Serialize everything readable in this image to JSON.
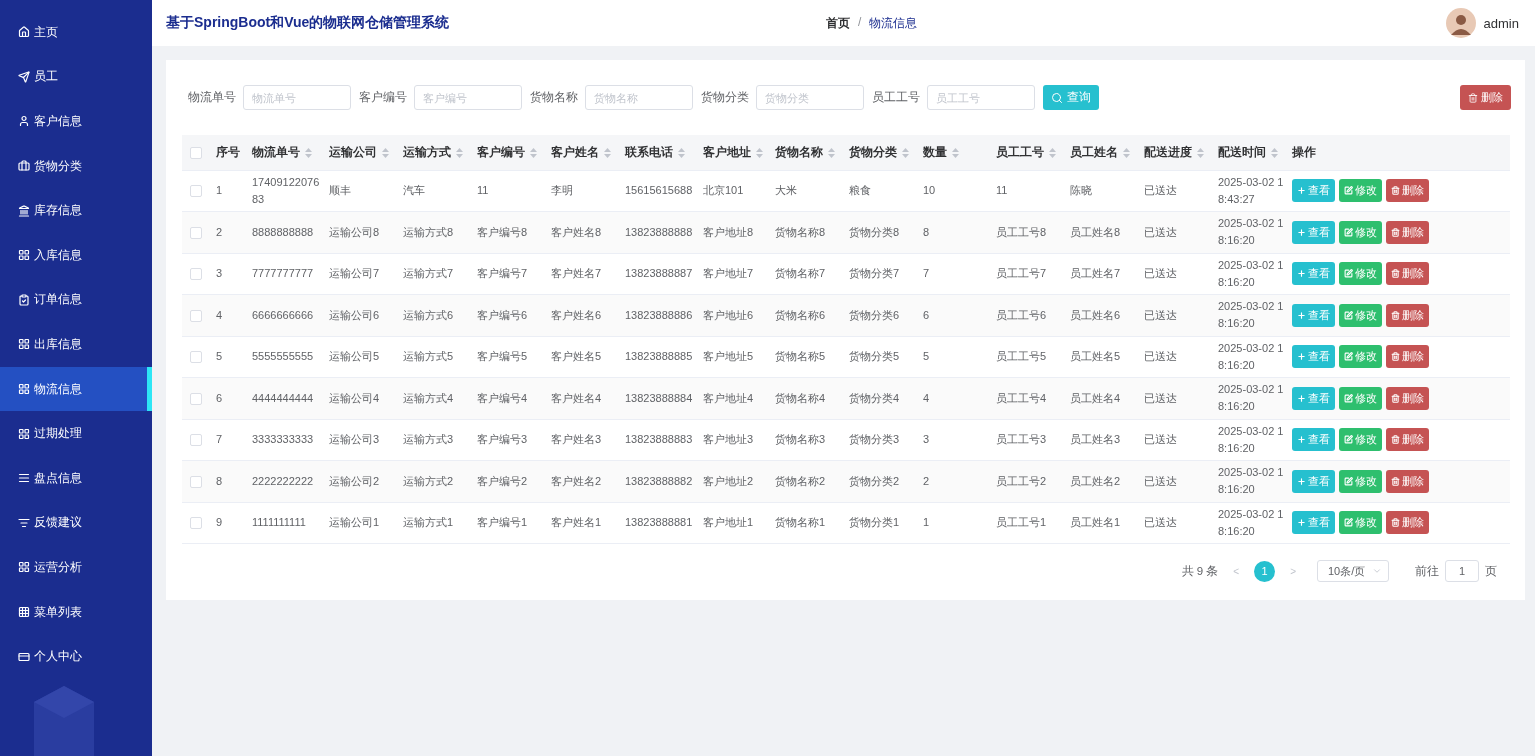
{
  "sidebar": {
    "items": [
      {
        "label": "主页",
        "selected": false
      },
      {
        "label": "员工",
        "selected": false
      },
      {
        "label": "客户信息",
        "selected": false
      },
      {
        "label": "货物分类",
        "selected": false
      },
      {
        "label": "库存信息",
        "selected": false
      },
      {
        "label": "入库信息",
        "selected": false
      },
      {
        "label": "订单信息",
        "selected": false
      },
      {
        "label": "出库信息",
        "selected": false
      },
      {
        "label": "物流信息",
        "selected": true
      },
      {
        "label": "过期处理",
        "selected": false
      },
      {
        "label": "盘点信息",
        "selected": false
      },
      {
        "label": "反馈建议",
        "selected": false
      },
      {
        "label": "运营分析",
        "selected": false
      },
      {
        "label": "菜单列表",
        "selected": false
      },
      {
        "label": "个人中心",
        "selected": false
      }
    ]
  },
  "header": {
    "title": "基于SpringBoot和Vue的物联网仓储管理系统",
    "breadcrumb": {
      "home": "首页",
      "separator": "/",
      "current": "物流信息"
    },
    "user": "admin"
  },
  "search": {
    "fields": [
      {
        "label": "物流单号",
        "placeholder": "物流单号"
      },
      {
        "label": "客户编号",
        "placeholder": "客户编号"
      },
      {
        "label": "货物名称",
        "placeholder": "货物名称"
      },
      {
        "label": "货物分类",
        "placeholder": "货物分类"
      },
      {
        "label": "员工工号",
        "placeholder": "员工工号"
      }
    ],
    "query_button": "查询",
    "delete_button": "删除"
  },
  "table": {
    "select_all": {
      "checked": false
    },
    "columns": [
      {
        "label": "序号",
        "sortable": false
      },
      {
        "label": "物流单号",
        "sortable": true
      },
      {
        "label": "运输公司",
        "sortable": true
      },
      {
        "label": "运输方式",
        "sortable": true
      },
      {
        "label": "客户编号",
        "sortable": true
      },
      {
        "label": "客户姓名",
        "sortable": true
      },
      {
        "label": "联系电话",
        "sortable": true
      },
      {
        "label": "客户地址",
        "sortable": true
      },
      {
        "label": "货物名称",
        "sortable": true
      },
      {
        "label": "货物分类",
        "sortable": true
      },
      {
        "label": "数量",
        "sortable": true
      },
      {
        "label": "员工工号",
        "sortable": true
      },
      {
        "label": "员工姓名",
        "sortable": true
      },
      {
        "label": "配送进度",
        "sortable": true
      },
      {
        "label": "配送时间",
        "sortable": true
      },
      {
        "label": "操作",
        "sortable": false
      }
    ],
    "rows": [
      {
        "checked": false,
        "cells": [
          "1",
          "1740912207683",
          "顺丰",
          "汽车",
          "11",
          "李明",
          "15615615688",
          "北京101",
          "大米",
          "粮食",
          "10",
          "11",
          "陈晓",
          "已送达",
          "2025-03-02 18:43:27"
        ],
        "actions": [
          {
            "kind": "view",
            "label": "查看"
          },
          {
            "kind": "edit",
            "label": "修改"
          },
          {
            "kind": "delete",
            "label": "删除"
          }
        ]
      },
      {
        "checked": false,
        "cells": [
          "2",
          "8888888888",
          "运输公司8",
          "运输方式8",
          "客户编号8",
          "客户姓名8",
          "13823888888",
          "客户地址8",
          "货物名称8",
          "货物分类8",
          "8",
          "员工工号8",
          "员工姓名8",
          "已送达",
          "2025-03-02 18:16:20"
        ],
        "actions": [
          {
            "kind": "view",
            "label": "查看"
          },
          {
            "kind": "edit",
            "label": "修改"
          },
          {
            "kind": "delete",
            "label": "删除"
          }
        ]
      },
      {
        "checked": false,
        "cells": [
          "3",
          "7777777777",
          "运输公司7",
          "运输方式7",
          "客户编号7",
          "客户姓名7",
          "13823888887",
          "客户地址7",
          "货物名称7",
          "货物分类7",
          "7",
          "员工工号7",
          "员工姓名7",
          "已送达",
          "2025-03-02 18:16:20"
        ],
        "actions": [
          {
            "kind": "view",
            "label": "查看"
          },
          {
            "kind": "edit",
            "label": "修改"
          },
          {
            "kind": "delete",
            "label": "删除"
          }
        ]
      },
      {
        "checked": false,
        "cells": [
          "4",
          "6666666666",
          "运输公司6",
          "运输方式6",
          "客户编号6",
          "客户姓名6",
          "13823888886",
          "客户地址6",
          "货物名称6",
          "货物分类6",
          "6",
          "员工工号6",
          "员工姓名6",
          "已送达",
          "2025-03-02 18:16:20"
        ],
        "actions": [
          {
            "kind": "view",
            "label": "查看"
          },
          {
            "kind": "edit",
            "label": "修改"
          },
          {
            "kind": "delete",
            "label": "删除"
          }
        ]
      },
      {
        "checked": false,
        "cells": [
          "5",
          "5555555555",
          "运输公司5",
          "运输方式5",
          "客户编号5",
          "客户姓名5",
          "13823888885",
          "客户地址5",
          "货物名称5",
          "货物分类5",
          "5",
          "员工工号5",
          "员工姓名5",
          "已送达",
          "2025-03-02 18:16:20"
        ],
        "actions": [
          {
            "kind": "view",
            "label": "查看"
          },
          {
            "kind": "edit",
            "label": "修改"
          },
          {
            "kind": "delete",
            "label": "删除"
          }
        ]
      },
      {
        "checked": false,
        "cells": [
          "6",
          "4444444444",
          "运输公司4",
          "运输方式4",
          "客户编号4",
          "客户姓名4",
          "13823888884",
          "客户地址4",
          "货物名称4",
          "货物分类4",
          "4",
          "员工工号4",
          "员工姓名4",
          "已送达",
          "2025-03-02 18:16:20"
        ],
        "actions": [
          {
            "kind": "view",
            "label": "查看"
          },
          {
            "kind": "edit",
            "label": "修改"
          },
          {
            "kind": "delete",
            "label": "删除"
          }
        ]
      },
      {
        "checked": false,
        "cells": [
          "7",
          "3333333333",
          "运输公司3",
          "运输方式3",
          "客户编号3",
          "客户姓名3",
          "13823888883",
          "客户地址3",
          "货物名称3",
          "货物分类3",
          "3",
          "员工工号3",
          "员工姓名3",
          "已送达",
          "2025-03-02 18:16:20"
        ],
        "actions": [
          {
            "kind": "view",
            "label": "查看"
          },
          {
            "kind": "edit",
            "label": "修改"
          },
          {
            "kind": "delete",
            "label": "删除"
          }
        ]
      },
      {
        "checked": false,
        "cells": [
          "8",
          "2222222222",
          "运输公司2",
          "运输方式2",
          "客户编号2",
          "客户姓名2",
          "13823888882",
          "客户地址2",
          "货物名称2",
          "货物分类2",
          "2",
          "员工工号2",
          "员工姓名2",
          "已送达",
          "2025-03-02 18:16:20"
        ],
        "actions": [
          {
            "kind": "view",
            "label": "查看"
          },
          {
            "kind": "edit",
            "label": "修改"
          },
          {
            "kind": "delete",
            "label": "删除"
          }
        ]
      },
      {
        "checked": false,
        "cells": [
          "9",
          "1111111111",
          "运输公司1",
          "运输方式1",
          "客户编号1",
          "客户姓名1",
          "13823888881",
          "客户地址1",
          "货物名称1",
          "货物分类1",
          "1",
          "员工工号1",
          "员工姓名1",
          "已送达",
          "2025-03-02 18:16:20"
        ],
        "actions": [
          {
            "kind": "view",
            "label": "查看"
          },
          {
            "kind": "edit",
            "label": "修改"
          },
          {
            "kind": "delete",
            "label": "删除"
          }
        ]
      }
    ]
  },
  "pagination": {
    "total": "共 9 条",
    "prev": "<",
    "pages": [
      {
        "label": "1",
        "selected": true
      }
    ],
    "next": ">",
    "page_size": "10条/页",
    "goto_label": "前往",
    "goto_value": "1",
    "goto_suffix": "页"
  }
}
